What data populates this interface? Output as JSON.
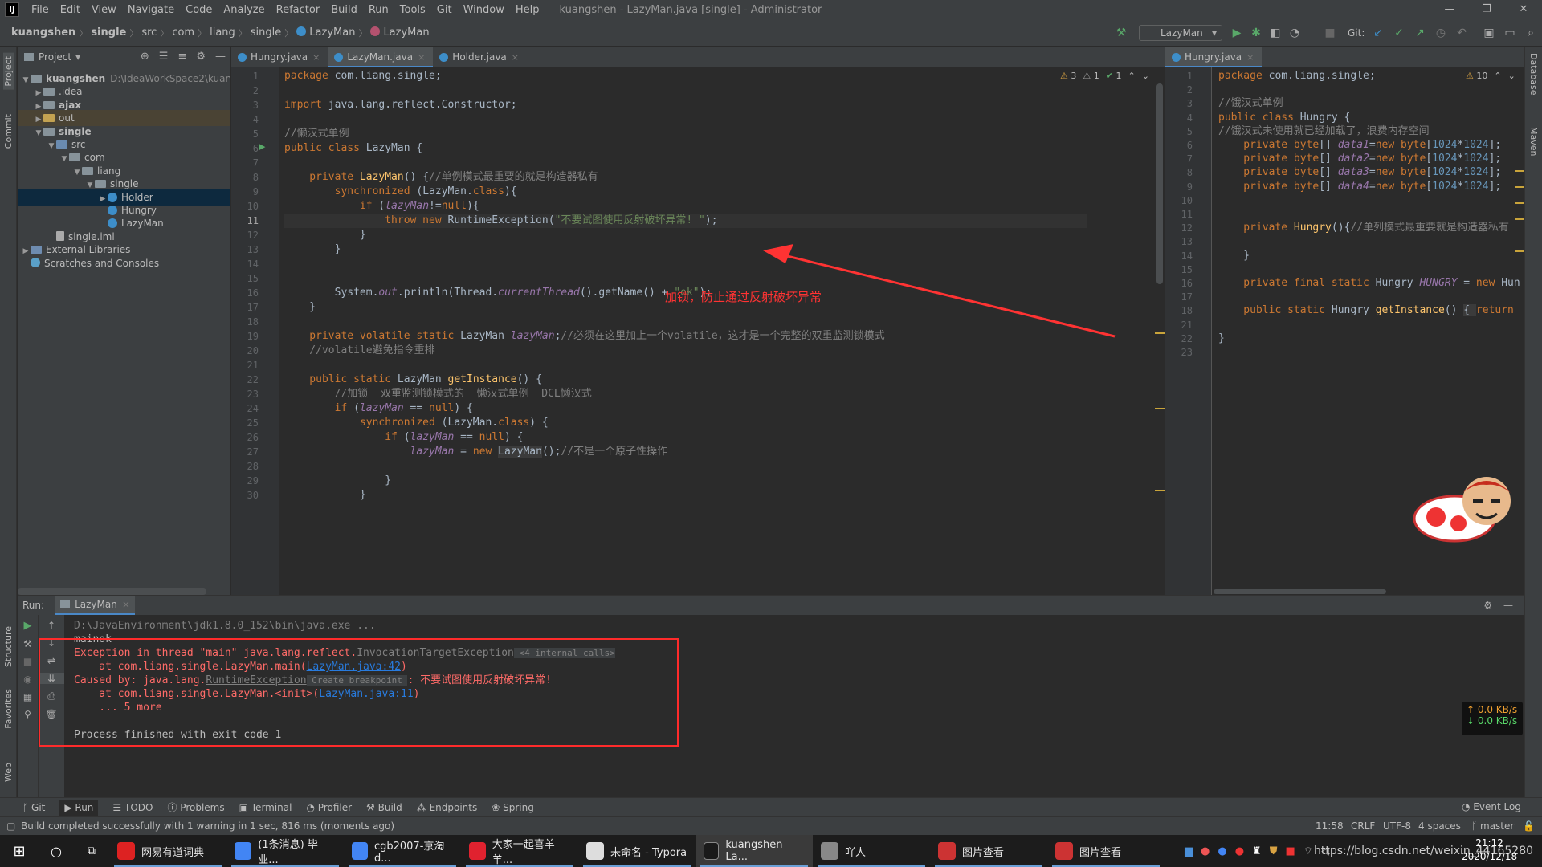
{
  "menu": {
    "items": [
      "File",
      "Edit",
      "View",
      "Navigate",
      "Code",
      "Analyze",
      "Refactor",
      "Build",
      "Run",
      "Tools",
      "Git",
      "Window",
      "Help"
    ],
    "window_title": "kuangshen - LazyMan.java [single] - Administrator",
    "window_buttons": [
      "—",
      "❐",
      "✕"
    ]
  },
  "navbar": {
    "crumbs": [
      "kuangshen",
      "single",
      "src",
      "com",
      "liang",
      "single",
      "LazyMan",
      "LazyMan"
    ],
    "run_config": "LazyMan",
    "git_label": "Git:"
  },
  "project": {
    "title": "Project",
    "tree": [
      {
        "label": "kuangshen",
        "extra": "D:\\IdeaWorkSpace2\\kuan",
        "depth": 0,
        "arrow": "▼",
        "kind": "folder",
        "bold": true
      },
      {
        "label": ".idea",
        "depth": 1,
        "arrow": "▶",
        "kind": "folder"
      },
      {
        "label": "ajax",
        "depth": 1,
        "arrow": "▶",
        "kind": "folder",
        "bold": true
      },
      {
        "label": "out",
        "depth": 1,
        "arrow": "▶",
        "kind": "folder-y"
      },
      {
        "label": "single",
        "depth": 1,
        "arrow": "▼",
        "kind": "folder",
        "bold": true
      },
      {
        "label": "src",
        "depth": 2,
        "arrow": "▼",
        "kind": "folder-b"
      },
      {
        "label": "com",
        "depth": 3,
        "arrow": "▼",
        "kind": "folder"
      },
      {
        "label": "liang",
        "depth": 4,
        "arrow": "▼",
        "kind": "folder"
      },
      {
        "label": "single",
        "depth": 5,
        "arrow": "▼",
        "kind": "folder"
      },
      {
        "label": "Holder",
        "depth": 6,
        "arrow": "▶",
        "kind": "class",
        "selected": true
      },
      {
        "label": "Hungry",
        "depth": 6,
        "arrow": "",
        "kind": "class"
      },
      {
        "label": "LazyMan",
        "depth": 6,
        "arrow": "",
        "kind": "class"
      },
      {
        "label": "single.iml",
        "depth": 2,
        "arrow": "",
        "kind": "file"
      },
      {
        "label": "External Libraries",
        "depth": 0,
        "arrow": "▶",
        "kind": "lib"
      },
      {
        "label": "Scratches and Consoles",
        "depth": 0,
        "arrow": "",
        "kind": "scratch"
      }
    ]
  },
  "editor_left": {
    "tabs": [
      {
        "label": "Hungry.java",
        "active": false
      },
      {
        "label": "LazyMan.java",
        "active": true
      },
      {
        "label": "Holder.java",
        "active": false
      }
    ],
    "inspections": {
      "warnings": "3",
      "weak": "1",
      "ok": "1"
    },
    "line_numbers": [
      "1",
      "2",
      "3",
      "4",
      "5",
      "6",
      "7",
      "8",
      "9",
      "10",
      "11",
      "12",
      "13",
      "14",
      "15",
      "16",
      "17",
      "18",
      "19",
      "20",
      "21",
      "22",
      "23",
      "24",
      "25",
      "26",
      "27",
      "28",
      "29",
      "30"
    ],
    "lines": [
      [
        {
          "t": "package ",
          "c": "kw"
        },
        {
          "t": "com.liang.single;",
          "c": ""
        }
      ],
      [],
      [
        {
          "t": "import ",
          "c": "kw"
        },
        {
          "t": "java.lang.reflect.Constructor;",
          "c": ""
        }
      ],
      [],
      [
        {
          "t": "//懒汉式单例",
          "c": "cm"
        }
      ],
      [
        {
          "t": "public class ",
          "c": "kw"
        },
        {
          "t": "LazyMan {",
          "c": ""
        }
      ],
      [],
      [
        {
          "t": "    private ",
          "c": "kw"
        },
        {
          "t": "LazyMan",
          "c": "fn"
        },
        {
          "t": "() {",
          "c": ""
        },
        {
          "t": "//单例模式最重要的就是构造器私有",
          "c": "cm"
        }
      ],
      [
        {
          "t": "        synchronized ",
          "c": "kw"
        },
        {
          "t": "(LazyMan.",
          "c": ""
        },
        {
          "t": "class",
          "c": "kw"
        },
        {
          "t": "){",
          "c": ""
        }
      ],
      [
        {
          "t": "            if ",
          "c": "kw"
        },
        {
          "t": "(",
          "c": ""
        },
        {
          "t": "lazyMan",
          "c": "fld"
        },
        {
          "t": "!=",
          "c": ""
        },
        {
          "t": "null",
          "c": "kw"
        },
        {
          "t": "){",
          "c": ""
        }
      ],
      [
        {
          "t": "                throw new ",
          "c": "kw"
        },
        {
          "t": "RuntimeException(",
          "c": ""
        },
        {
          "t": "\"不要试图使用反射破坏异常! \"",
          "c": "st"
        },
        {
          "t": ");",
          "c": ""
        }
      ],
      [
        {
          "t": "            }",
          "c": ""
        }
      ],
      [
        {
          "t": "        }",
          "c": ""
        }
      ],
      [],
      [],
      [
        {
          "t": "        System.",
          "c": ""
        },
        {
          "t": "out",
          "c": "fld"
        },
        {
          "t": ".println(Thread.",
          "c": ""
        },
        {
          "t": "currentThread",
          "c": "fld"
        },
        {
          "t": "().getName() + ",
          "c": ""
        },
        {
          "t": "\"ok\"",
          "c": "st"
        },
        {
          "t": ");",
          "c": ""
        }
      ],
      [
        {
          "t": "    }",
          "c": ""
        }
      ],
      [],
      [
        {
          "t": "    private volatile static ",
          "c": "kw"
        },
        {
          "t": "LazyMan ",
          "c": ""
        },
        {
          "t": "lazyMan",
          "c": "fld"
        },
        {
          "t": ";",
          "c": ""
        },
        {
          "t": "//必须在这里加上一个volatile，这才是一个完整的双重监测锁模式",
          "c": "cm"
        }
      ],
      [
        {
          "t": "    //volatile避免指令重排",
          "c": "cm"
        }
      ],
      [],
      [
        {
          "t": "    public static ",
          "c": "kw"
        },
        {
          "t": "LazyMan ",
          "c": ""
        },
        {
          "t": "getInstance",
          "c": "fn"
        },
        {
          "t": "() {",
          "c": ""
        }
      ],
      [
        {
          "t": "        //加锁  双重监测锁模式的  懒汉式单例  DCL懒汉式",
          "c": "cm"
        }
      ],
      [
        {
          "t": "        if ",
          "c": "kw"
        },
        {
          "t": "(",
          "c": ""
        },
        {
          "t": "lazyMan",
          "c": "fld"
        },
        {
          "t": " == ",
          "c": ""
        },
        {
          "t": "null",
          "c": "kw"
        },
        {
          "t": ") {",
          "c": ""
        }
      ],
      [
        {
          "t": "            synchronized ",
          "c": "kw"
        },
        {
          "t": "(LazyMan.",
          "c": ""
        },
        {
          "t": "class",
          "c": "kw"
        },
        {
          "t": ") {",
          "c": ""
        }
      ],
      [
        {
          "t": "                if ",
          "c": "kw"
        },
        {
          "t": "(",
          "c": ""
        },
        {
          "t": "lazyMan",
          "c": "fld"
        },
        {
          "t": " == ",
          "c": ""
        },
        {
          "t": "null",
          "c": "kw"
        },
        {
          "t": ") {",
          "c": ""
        }
      ],
      [
        {
          "t": "                    ",
          "c": ""
        },
        {
          "t": "lazyMan",
          "c": "fld"
        },
        {
          "t": " = ",
          "c": ""
        },
        {
          "t": "new ",
          "c": "kw"
        },
        {
          "t": "LazyMan",
          "c": "hl2"
        },
        {
          "t": "();",
          "c": ""
        },
        {
          "t": "//不是一个原子性操作",
          "c": "cm"
        }
      ],
      [],
      [
        {
          "t": "                }",
          "c": ""
        }
      ],
      [
        {
          "t": "            }",
          "c": ""
        }
      ]
    ],
    "annotation": "加锁，防止通过反射破坏异常"
  },
  "editor_right": {
    "tabs": [
      {
        "label": "Hungry.java",
        "active": true
      }
    ],
    "inspections": {
      "warnings": "10"
    },
    "line_numbers": [
      "1",
      "2",
      "3",
      "4",
      "5",
      "6",
      "7",
      "8",
      "9",
      "10",
      "11",
      "12",
      "13",
      "14",
      "15",
      "16",
      "17",
      "18",
      "21",
      "22",
      "23"
    ],
    "lines": [
      [
        {
          "t": "package ",
          "c": "kw"
        },
        {
          "t": "com.liang.single;",
          "c": ""
        }
      ],
      [],
      [
        {
          "t": "//饿汉式单例",
          "c": "cm"
        }
      ],
      [
        {
          "t": "public class ",
          "c": "kw"
        },
        {
          "t": "Hungry {",
          "c": ""
        }
      ],
      [
        {
          "t": "//饿汉式未使用就已经加载了，浪费内存空间",
          "c": "cm"
        }
      ],
      [
        {
          "t": "    private byte",
          "c": "kw"
        },
        {
          "t": "[] ",
          "c": ""
        },
        {
          "t": "data1",
          "c": "fld"
        },
        {
          "t": "=",
          "c": ""
        },
        {
          "t": "new byte",
          "c": "kw"
        },
        {
          "t": "[",
          "c": ""
        },
        {
          "t": "1024",
          "c": "nm"
        },
        {
          "t": "*",
          "c": ""
        },
        {
          "t": "1024",
          "c": "nm"
        },
        {
          "t": "];",
          "c": ""
        }
      ],
      [
        {
          "t": "    private byte",
          "c": "kw"
        },
        {
          "t": "[] ",
          "c": ""
        },
        {
          "t": "data2",
          "c": "fld"
        },
        {
          "t": "=",
          "c": ""
        },
        {
          "t": "new byte",
          "c": "kw"
        },
        {
          "t": "[",
          "c": ""
        },
        {
          "t": "1024",
          "c": "nm"
        },
        {
          "t": "*",
          "c": ""
        },
        {
          "t": "1024",
          "c": "nm"
        },
        {
          "t": "];",
          "c": ""
        }
      ],
      [
        {
          "t": "    private byte",
          "c": "kw"
        },
        {
          "t": "[] ",
          "c": ""
        },
        {
          "t": "data3",
          "c": "fld"
        },
        {
          "t": "=",
          "c": ""
        },
        {
          "t": "new byte",
          "c": "kw"
        },
        {
          "t": "[",
          "c": ""
        },
        {
          "t": "1024",
          "c": "nm"
        },
        {
          "t": "*",
          "c": ""
        },
        {
          "t": "1024",
          "c": "nm"
        },
        {
          "t": "];",
          "c": ""
        }
      ],
      [
        {
          "t": "    private byte",
          "c": "kw"
        },
        {
          "t": "[] ",
          "c": ""
        },
        {
          "t": "data4",
          "c": "fld"
        },
        {
          "t": "=",
          "c": ""
        },
        {
          "t": "new byte",
          "c": "kw"
        },
        {
          "t": "[",
          "c": ""
        },
        {
          "t": "1024",
          "c": "nm"
        },
        {
          "t": "*",
          "c": ""
        },
        {
          "t": "1024",
          "c": "nm"
        },
        {
          "t": "];",
          "c": ""
        }
      ],
      [],
      [],
      [
        {
          "t": "    private ",
          "c": "kw"
        },
        {
          "t": "Hungry",
          "c": "fn"
        },
        {
          "t": "(){",
          "c": ""
        },
        {
          "t": "//单列模式最重要就是构造器私有",
          "c": "cm"
        }
      ],
      [],
      [
        {
          "t": "    }",
          "c": ""
        }
      ],
      [],
      [
        {
          "t": "    private final static ",
          "c": "kw"
        },
        {
          "t": "Hungry ",
          "c": ""
        },
        {
          "t": "HUNGRY",
          "c": "fld"
        },
        {
          "t": " = ",
          "c": ""
        },
        {
          "t": "new ",
          "c": "kw"
        },
        {
          "t": "Hun",
          "c": ""
        }
      ],
      [],
      [
        {
          "t": "    public static ",
          "c": "kw"
        },
        {
          "t": "Hungry ",
          "c": ""
        },
        {
          "t": "getInstance",
          "c": "fn"
        },
        {
          "t": "() ",
          "c": ""
        },
        {
          "t": "{ ",
          "c": "hl2"
        },
        {
          "t": "return ",
          "c": "kw"
        }
      ],
      [],
      [
        {
          "t": "}",
          "c": ""
        }
      ],
      []
    ]
  },
  "run": {
    "label": "Run:",
    "tab": "LazyMan",
    "console": [
      [
        {
          "t": "D:\\JavaEnvironment\\jdk1.8.0_152\\bin\\java.exe ...",
          "c": "cm"
        }
      ],
      [
        {
          "t": "mainok",
          "c": ""
        }
      ],
      [
        {
          "t": "Exception in thread \"main\" java.lang.reflect.",
          "c": "err"
        },
        {
          "t": "InvocationTargetException",
          "c": "ulnk cm"
        },
        {
          "t": " <4 internal calls>",
          "c": "cm"
        }
      ],
      [
        {
          "t": "    at com.liang.single.LazyMan.main(",
          "c": "err"
        },
        {
          "t": "LazyMan.java:42",
          "c": "lnk"
        },
        {
          "t": ")",
          "c": "err"
        }
      ],
      [
        {
          "t": "Caused by: java.lang.",
          "c": "err"
        },
        {
          "t": "RuntimeException",
          "c": "ulnk cm"
        },
        {
          "t": " Create breakpoint ",
          "c": "cm"
        },
        {
          "t": ": 不要试图使用反射破坏异常!",
          "c": "err"
        }
      ],
      [
        {
          "t": "    at com.liang.single.LazyMan.<init>(",
          "c": "err"
        },
        {
          "t": "LazyMan.java:11",
          "c": "lnk"
        },
        {
          "t": ")",
          "c": "err"
        }
      ],
      [
        {
          "t": "    ... 5 more",
          "c": "err"
        }
      ],
      [],
      [
        {
          "t": "Process finished with exit code 1",
          "c": ""
        }
      ]
    ]
  },
  "bottom_tabs": [
    "Git",
    "Run",
    "TODO",
    "Problems",
    "Terminal",
    "Profiler",
    "Build",
    "Endpoints",
    "Spring"
  ],
  "event_log": "Event Log",
  "status": {
    "message": "Build completed successfully with 1 warning in 1 sec, 816 ms (moments ago)",
    "position": "11:58",
    "line_sep": "CRLF",
    "encoding": "UTF-8",
    "indent": "4 spaces",
    "branch": "master"
  },
  "network": {
    "up": "↑ 0.0 KB/s",
    "down": "↓ 0.0 KB/s"
  },
  "side_labels": {
    "project": "Project",
    "commit": "Commit",
    "structure": "Structure",
    "favorites": "Favorites",
    "web": "Web",
    "database": "Database",
    "maven": "Maven"
  },
  "taskbar": {
    "items": [
      {
        "label": "网易有道词典",
        "color": "#d22"
      },
      {
        "label": "(1条消息) 毕业...",
        "color": "#4285f4"
      },
      {
        "label": "cgb2007-京淘d...",
        "color": "#4285f4"
      },
      {
        "label": "大家一起喜羊羊...",
        "color": "#e0222f"
      },
      {
        "label": "未命名 - Typora",
        "color": "#ddd"
      },
      {
        "label": "kuangshen – La...",
        "color": "#1a1a1a"
      },
      {
        "label": "吖人",
        "color": "#888"
      },
      {
        "label": "图片查看",
        "color": "#c33"
      },
      {
        "label": "图片查看",
        "color": "#c33"
      }
    ],
    "time": "21:12",
    "date": "2020/12/18",
    "watermark": "https://blog.csdn.net/weixin_44165280"
  }
}
